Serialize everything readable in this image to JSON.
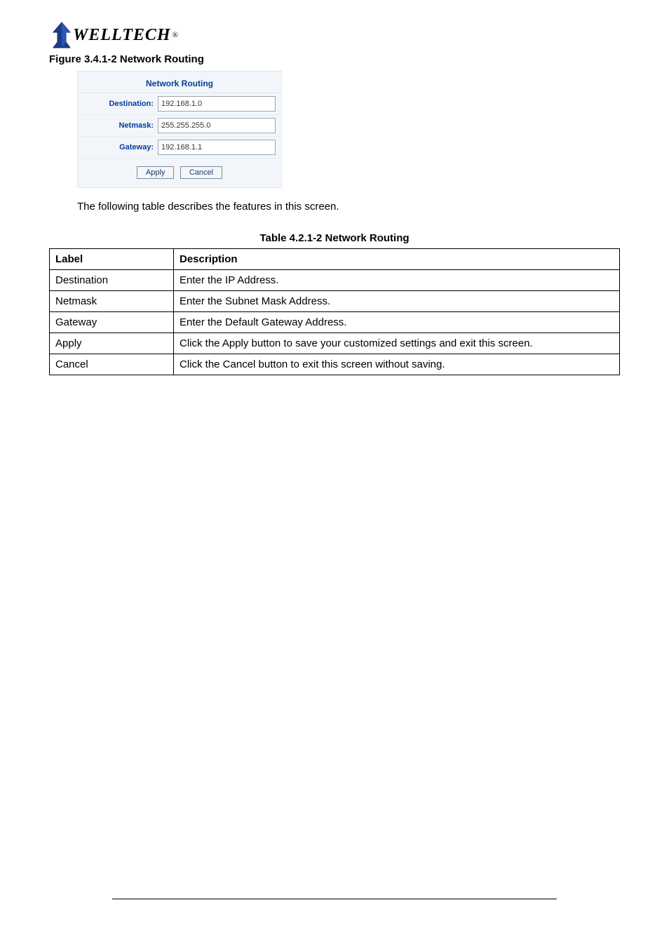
{
  "logo": {
    "text": "WELLTECH",
    "reg": "®"
  },
  "figure_caption": "Figure   3.4.1-2 Network Routing",
  "network_routing_panel": {
    "title": "Network Routing",
    "rows": [
      {
        "label": "Destination:",
        "value": "192.168.1.0"
      },
      {
        "label": "Netmask:",
        "value": "255.255.255.0"
      },
      {
        "label": "Gateway:",
        "value": "192.168.1.1"
      }
    ],
    "apply_label": "Apply",
    "cancel_label": "Cancel"
  },
  "body_text": "The following table describes the features in this screen.",
  "table_caption": "Table 4.2.1-2 Network Routing",
  "table": {
    "header": {
      "label": "Label",
      "description": "Description"
    },
    "rows": [
      {
        "label": "Destination",
        "description": "Enter the IP Address."
      },
      {
        "label": "Netmask",
        "description": "Enter the Subnet Mask Address."
      },
      {
        "label": "Gateway",
        "description": "Enter the Default Gateway Address."
      },
      {
        "label": "Apply",
        "description": "Click the Apply button to save your customized settings and exit this screen."
      },
      {
        "label": "Cancel",
        "description": "Click the Cancel button to exit this screen without saving."
      }
    ]
  }
}
